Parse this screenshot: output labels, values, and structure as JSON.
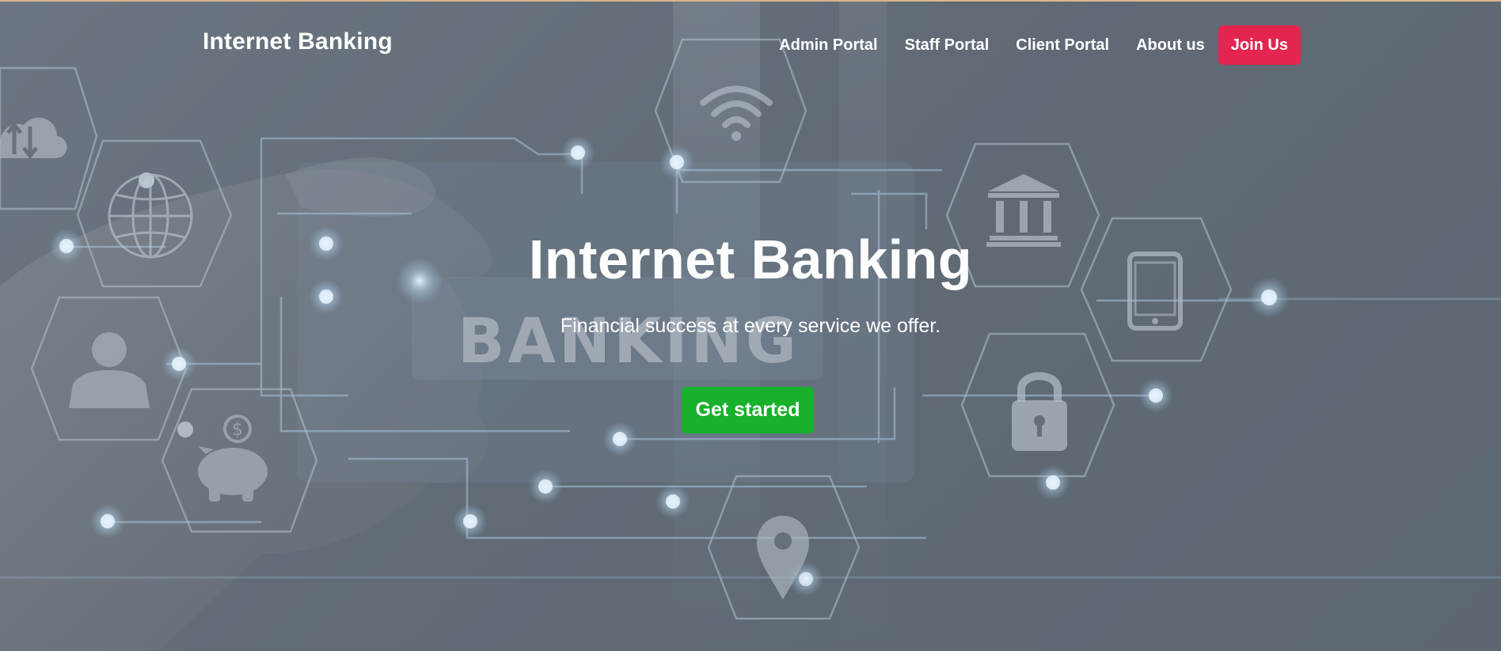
{
  "navbar": {
    "brand": "Internet Banking",
    "links": [
      {
        "label": "Admin Portal"
      },
      {
        "label": "Staff Portal"
      },
      {
        "label": "Client Portal"
      },
      {
        "label": "About us"
      }
    ],
    "cta_label": "Join Us"
  },
  "hero": {
    "title": "Internet Banking",
    "subtitle": "Financial success at every service we offer.",
    "cta_label": "Get started",
    "background_text": "BANKING"
  },
  "colors": {
    "overlay": "#606b76",
    "join_button": "#e4254f",
    "get_started_button": "#17b12b",
    "text": "#ffffff"
  },
  "icons": [
    "cloud-transfer-icon",
    "globe-icon",
    "user-icon",
    "piggy-bank-icon",
    "wifi-icon",
    "bank-icon",
    "tablet-icon",
    "lock-icon",
    "location-pin-icon"
  ]
}
